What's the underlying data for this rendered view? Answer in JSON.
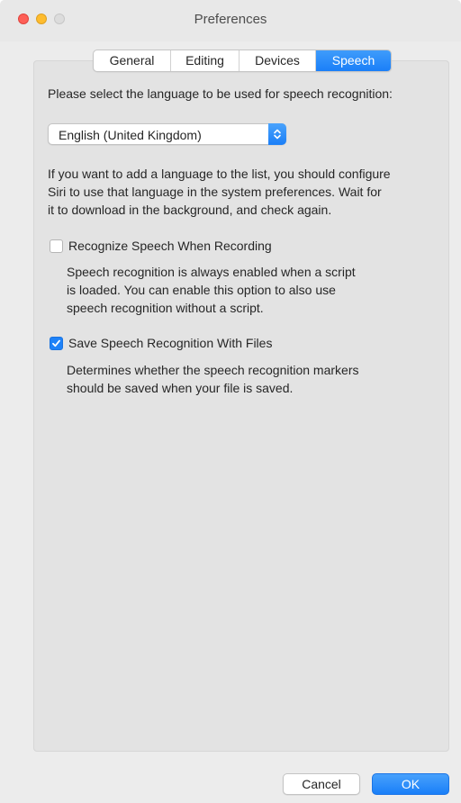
{
  "window": {
    "title": "Preferences"
  },
  "tabs": [
    {
      "label": "General",
      "active": false
    },
    {
      "label": "Editing",
      "active": false
    },
    {
      "label": "Devices",
      "active": false
    },
    {
      "label": "Speech",
      "active": true
    }
  ],
  "speech": {
    "language_prompt": "Please select the language to be used for speech recognition:",
    "language_select": {
      "value": "English (United Kingdom)"
    },
    "info_lines": [
      "If you want to add a language to the list, you should configure",
      "Siri to use that language in the system preferences. Wait for",
      "it to download in the background, and check again."
    ],
    "options": [
      {
        "label": "Recognize Speech When Recording",
        "checked": false,
        "description_lines": [
          "Speech recognition is always enabled when a script",
          "is loaded. You can enable this option to also use",
          "speech recognition without a script."
        ]
      },
      {
        "label": "Save Speech Recognition With Files",
        "checked": true,
        "description_lines": [
          "Determines whether the speech recognition markers",
          "should be saved when your file is saved."
        ]
      }
    ]
  },
  "footer": {
    "cancel_label": "Cancel",
    "ok_label": "OK"
  },
  "colors": {
    "accent": "#1a7ff8",
    "close": "#fe5f57",
    "minimize": "#febc2e",
    "zoom_disabled": "#dcdcdc"
  }
}
